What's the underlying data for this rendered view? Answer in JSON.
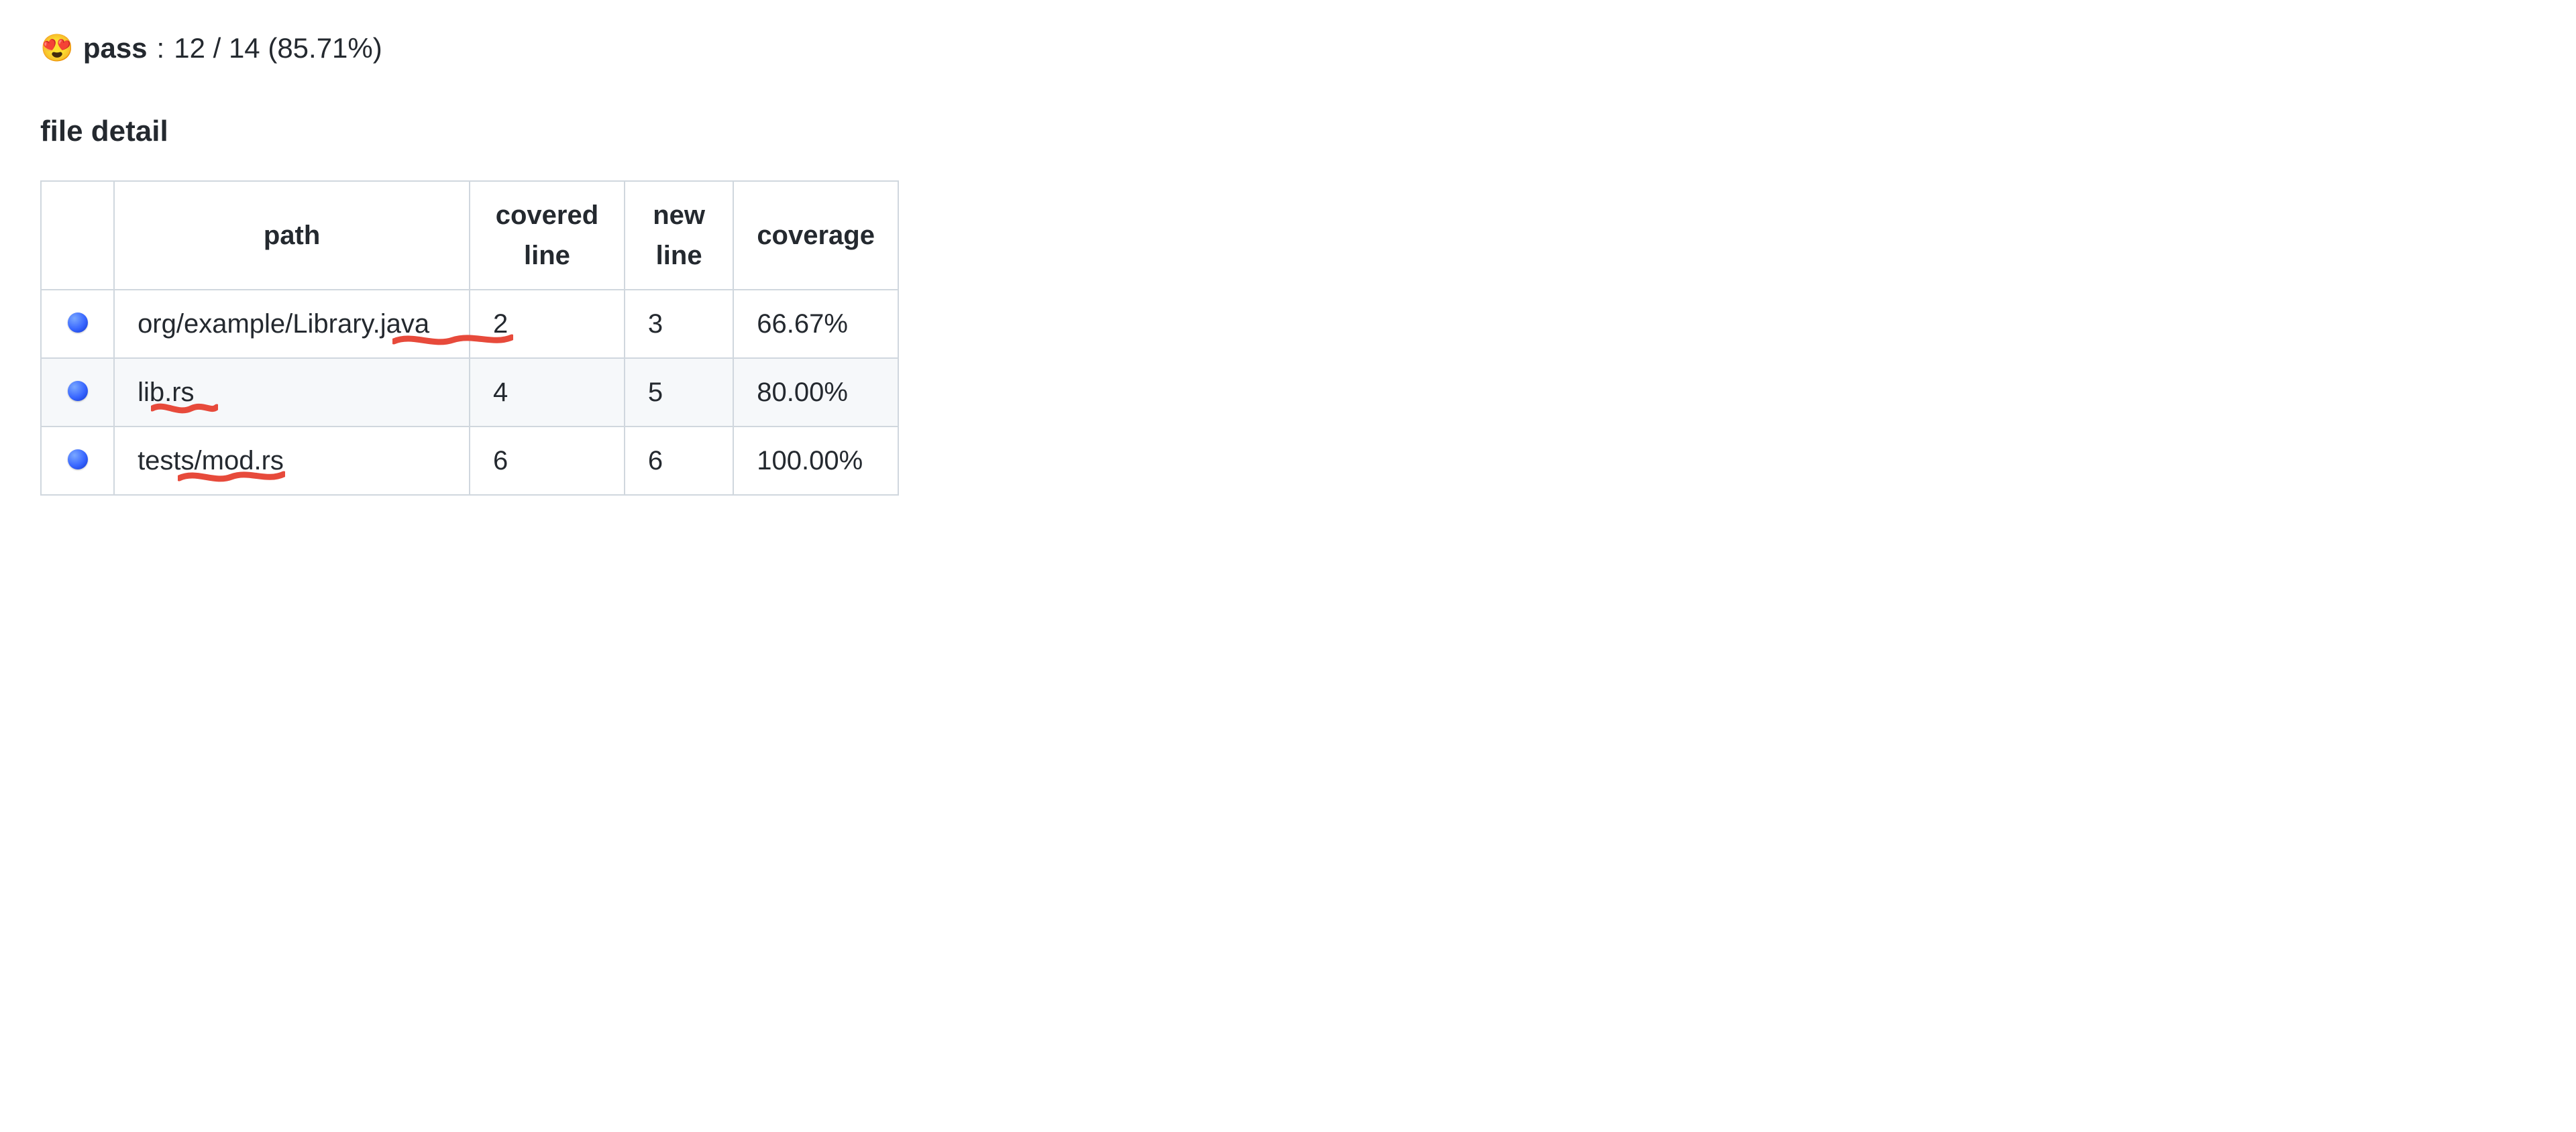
{
  "summary": {
    "emoji": "😍",
    "label": "pass",
    "value": "12 / 14 (85.71%)"
  },
  "section_heading": "file detail",
  "table": {
    "headers": {
      "status": "",
      "path": "path",
      "covered": "covered line",
      "newline": "new line",
      "coverage": "coverage"
    },
    "rows": [
      {
        "path": "org/example/Library.java",
        "covered": "2",
        "newline": "3",
        "coverage": "66.67%"
      },
      {
        "path": "lib.rs",
        "covered": "4",
        "newline": "5",
        "coverage": "80.00%"
      },
      {
        "path": "tests/mod.rs",
        "covered": "6",
        "newline": "6",
        "coverage": "100.00%"
      }
    ]
  },
  "annotations": {
    "squiggle_color": "#e74a3b"
  }
}
